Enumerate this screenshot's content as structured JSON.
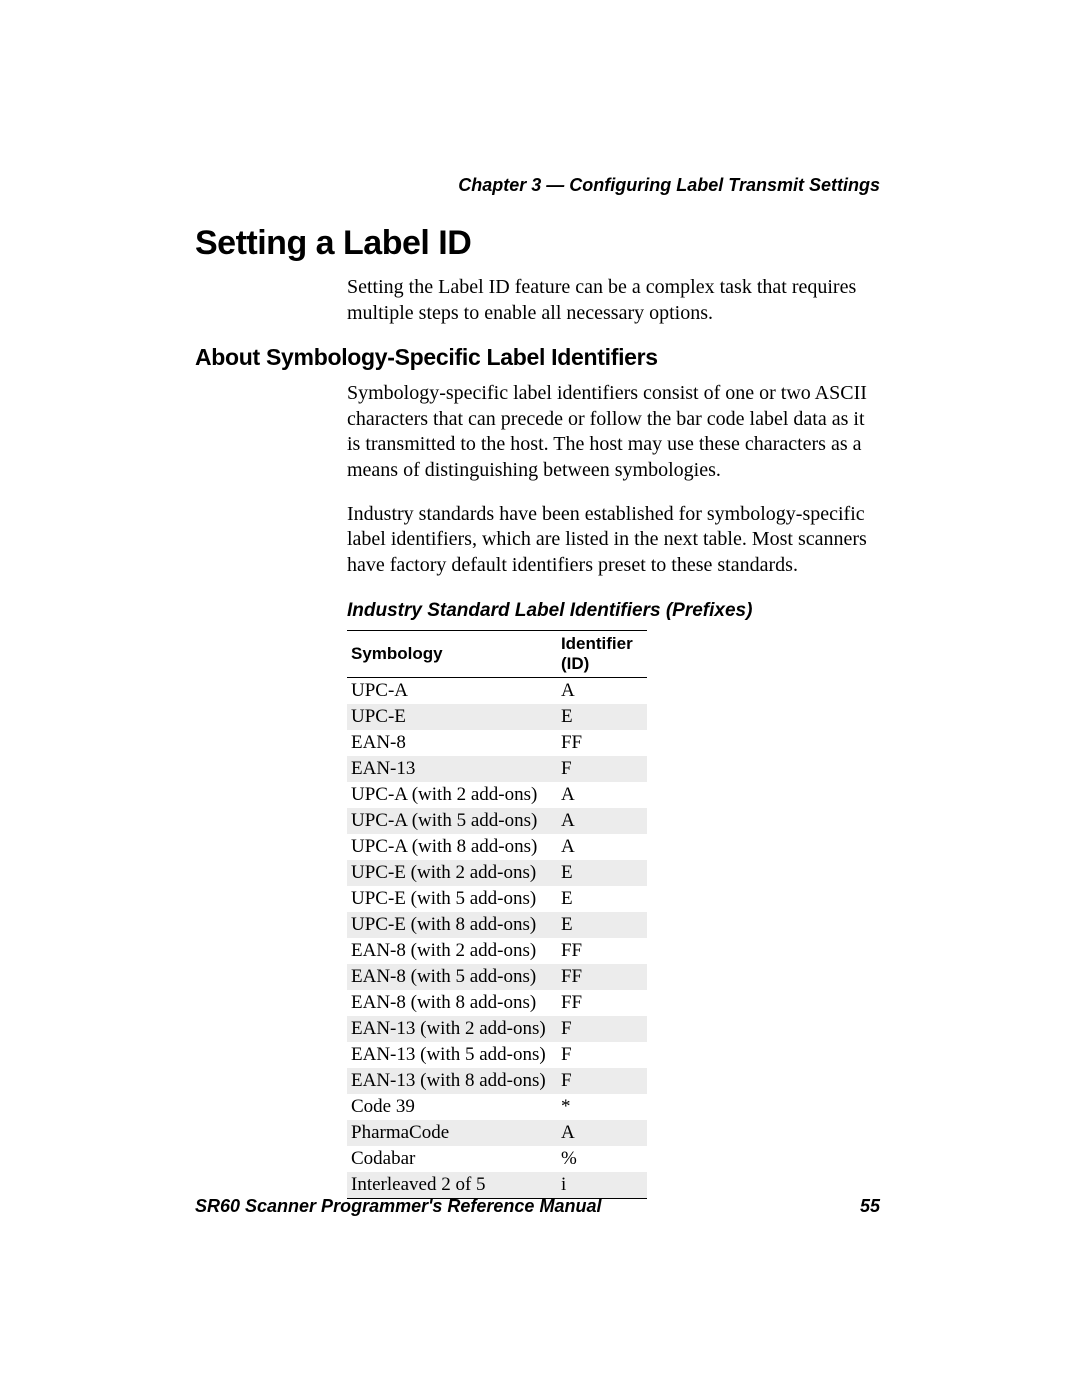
{
  "header": {
    "chapter_line": "Chapter 3 — Configuring Label Transmit Settings"
  },
  "h1": "Setting a Label ID",
  "intro_para": "Setting the Label ID feature can be a complex task that requires multiple steps to enable all necessary options.",
  "h2": "About Symbology-Specific Label Identifiers",
  "para1": "Symbology-specific label identifiers consist of one or two ASCII characters that can precede or follow the bar code label data as it is transmitted to the host. The host may use these characters as a means of distinguishing between symbologies.",
  "para2": "Industry standards have been established for symbology-specific label identifiers, which are listed in the next table. Most scanners have factory default identifiers preset to these standards.",
  "table": {
    "caption": "Industry Standard Label Identifiers (Prefixes)",
    "head": {
      "symbology": "Symbology",
      "identifier": "Identifier (ID)"
    },
    "rows": [
      {
        "symbology": "UPC-A",
        "identifier": "A"
      },
      {
        "symbology": "UPC-E",
        "identifier": "E"
      },
      {
        "symbology": "EAN-8",
        "identifier": "FF"
      },
      {
        "symbology": "EAN-13",
        "identifier": "F"
      },
      {
        "symbology": "UPC-A (with 2 add-ons)",
        "identifier": "A"
      },
      {
        "symbology": "UPC-A (with 5 add-ons)",
        "identifier": "A"
      },
      {
        "symbology": "UPC-A (with 8 add-ons)",
        "identifier": "A"
      },
      {
        "symbology": "UPC-E (with 2 add-ons)",
        "identifier": "E"
      },
      {
        "symbology": "UPC-E (with 5 add-ons)",
        "identifier": "E"
      },
      {
        "symbology": "UPC-E (with 8 add-ons)",
        "identifier": "E"
      },
      {
        "symbology": "EAN-8 (with 2 add-ons)",
        "identifier": "FF"
      },
      {
        "symbology": "EAN-8 (with 5 add-ons)",
        "identifier": "FF"
      },
      {
        "symbology": "EAN-8 (with 8 add-ons)",
        "identifier": "FF"
      },
      {
        "symbology": "EAN-13 (with 2 add-ons)",
        "identifier": "F"
      },
      {
        "symbology": "EAN-13 (with 5 add-ons)",
        "identifier": "F"
      },
      {
        "symbology": "EAN-13 (with 8 add-ons)",
        "identifier": "F"
      },
      {
        "symbology": "Code 39",
        "identifier": "*"
      },
      {
        "symbology": "PharmaCode",
        "identifier": "A"
      },
      {
        "symbology": "Codabar",
        "identifier": "%"
      },
      {
        "symbology": "Interleaved 2 of 5",
        "identifier": "i"
      }
    ]
  },
  "footer": {
    "manual_title": "SR60 Scanner Programmer's Reference Manual",
    "page_number": "55"
  }
}
